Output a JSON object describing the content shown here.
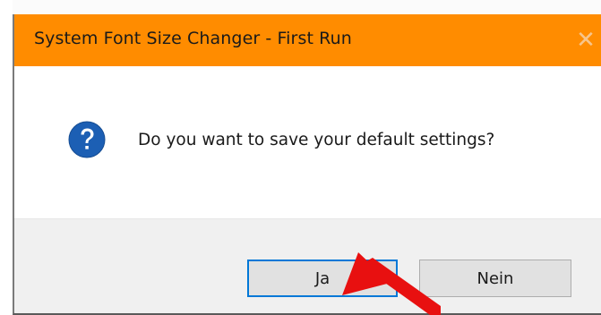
{
  "dialog": {
    "title": "System Font Size Changer - First Run",
    "close_icon": "close-icon",
    "message": "Do you want to save your default settings?",
    "icon": "question-icon",
    "buttons": {
      "yes": "Ja",
      "no": "Nein"
    }
  },
  "colors": {
    "titlebar": "#ff8c00",
    "question_icon": "#1c5fb4",
    "focus_border": "#0078d7",
    "annotation_arrow": "#e81010"
  },
  "annotation": {
    "icon": "red-arrow-icon"
  }
}
